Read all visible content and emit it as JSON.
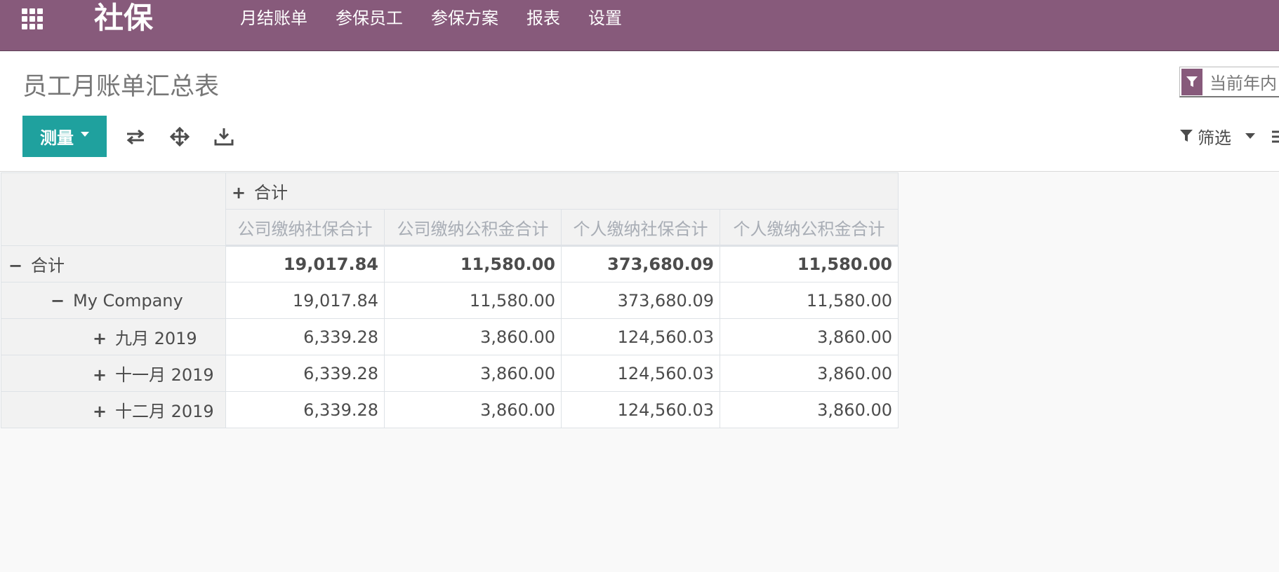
{
  "navbar": {
    "brand": "社保",
    "menu": [
      "月结账单",
      "参保员工",
      "参保方案",
      "报表",
      "设置"
    ],
    "color": "#875a7b"
  },
  "control_panel": {
    "title": "员工月账单汇总表",
    "search_facet": "当前年内",
    "measure_button": "测量",
    "filter_button": "筛选",
    "accent_color": "#1fa19e",
    "icons": [
      "flip-axis-icon",
      "expand-all-icon",
      "download-icon",
      "filter-icon",
      "group-by-icon"
    ]
  },
  "pivot": {
    "column_group": "合计",
    "measures": [
      "公司缴纳社保合计",
      "公司缴纳公积金合计",
      "个人缴纳社保合计",
      "个人缴纳公积金合计"
    ],
    "rows": [
      {
        "label": "合计",
        "toggle": "−",
        "values": [
          "19,017.84",
          "11,580.00",
          "373,680.09",
          "11,580.00"
        ]
      },
      {
        "label": "My Company",
        "toggle": "−",
        "values": [
          "19,017.84",
          "11,580.00",
          "373,680.09",
          "11,580.00"
        ]
      },
      {
        "label": "九月 2019",
        "toggle": "+",
        "values": [
          "6,339.28",
          "3,860.00",
          "124,560.03",
          "3,860.00"
        ]
      },
      {
        "label": "十一月 2019",
        "toggle": "+",
        "values": [
          "6,339.28",
          "3,860.00",
          "124,560.03",
          "3,860.00"
        ]
      },
      {
        "label": "十二月 2019",
        "toggle": "+",
        "values": [
          "6,339.28",
          "3,860.00",
          "124,560.03",
          "3,860.00"
        ]
      }
    ],
    "column_group_toggle": "+"
  }
}
